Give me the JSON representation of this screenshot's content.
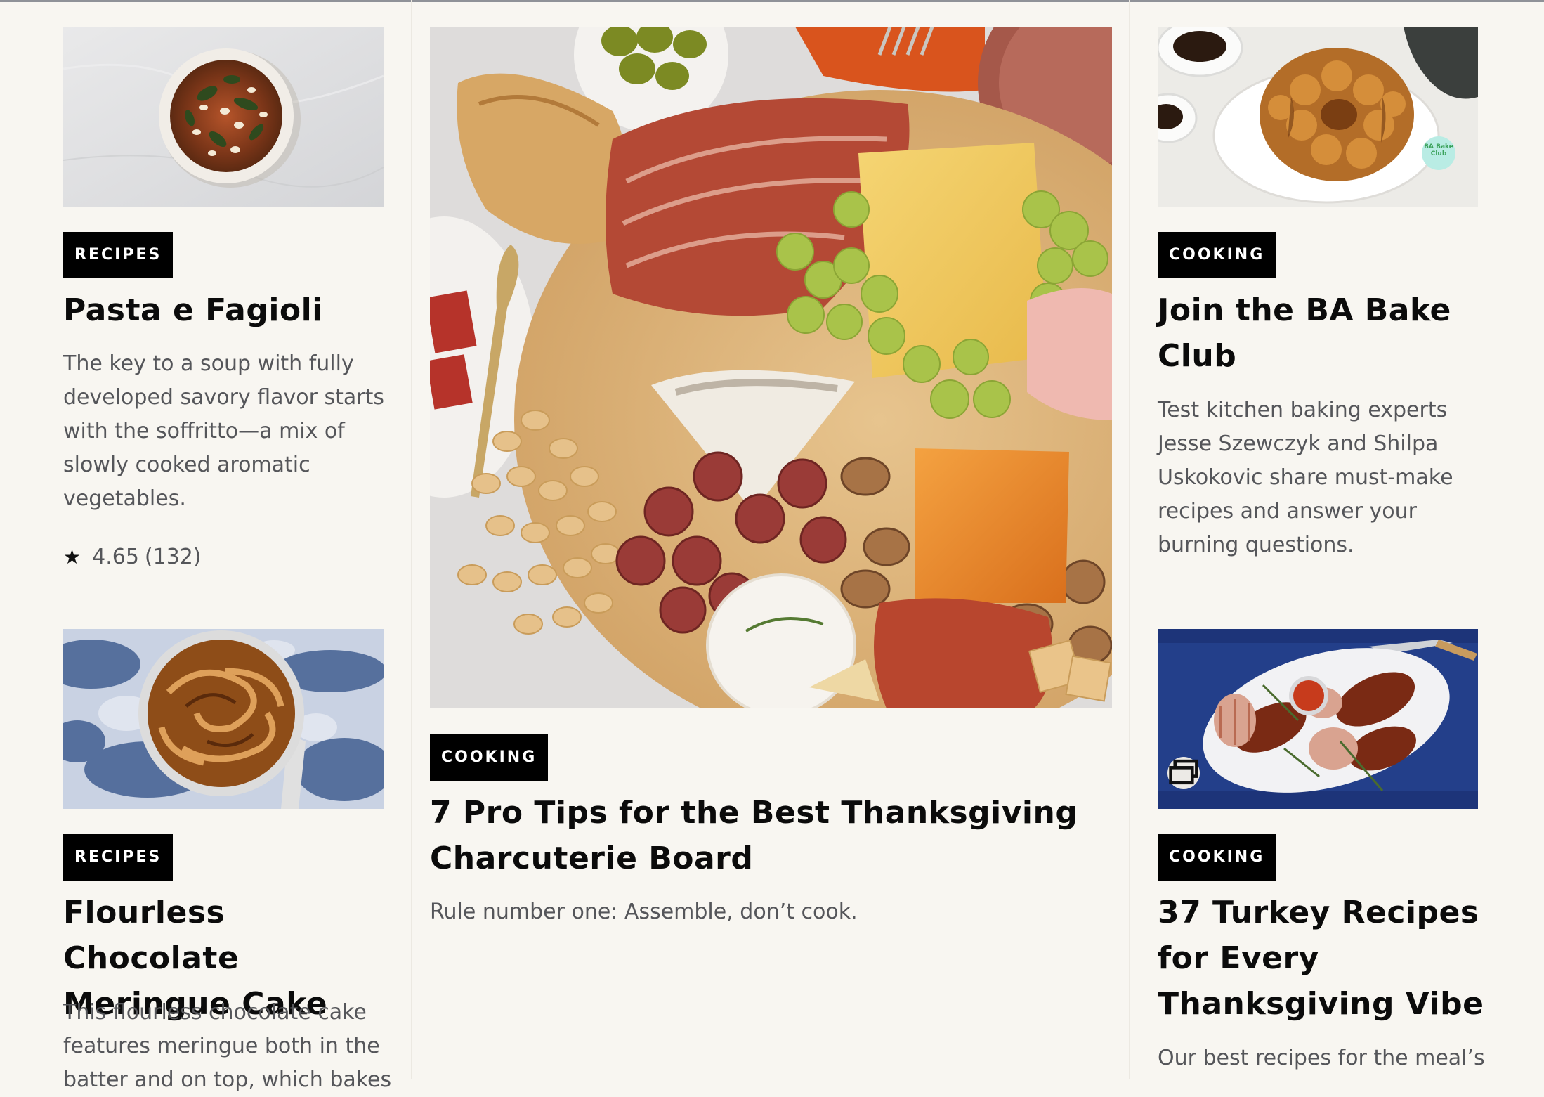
{
  "cards": {
    "pasta": {
      "category": "RECIPES",
      "title": "Pasta e Fagioli",
      "dek_lines": [
        "The key to a soup with fully",
        "developed savory flavor starts",
        "with the soffritto—a mix of",
        "slowly cooked aromatic",
        "vegetables."
      ],
      "rating_value": "4.65",
      "rating_count": "(132)"
    },
    "charcuterie": {
      "category": "COOKING",
      "title_lines": [
        "7 Pro Tips for the Best Thanksgiving",
        "Charcuterie Board"
      ],
      "dek": "Rule number one: Assemble, don’t cook."
    },
    "bakeclub": {
      "category": "COOKING",
      "title_lines": [
        "Join the BA Bake",
        "Club"
      ],
      "dek_lines": [
        "Test kitchen baking experts",
        "Jesse Szewczyk and Shilpa",
        "Uskokovic share must-make",
        "recipes and answer your",
        "burning questions."
      ],
      "image_badge_text": "BA Bake Club"
    },
    "chocolate": {
      "category": "RECIPES",
      "title_lines": [
        "Flourless Chocolate",
        "Meringue Cake"
      ],
      "dek_lines": [
        "This flourless chocolate cake",
        "features meringue both in the",
        "batter and on top, which bakes"
      ]
    },
    "turkey": {
      "category": "COOKING",
      "title_lines": [
        "37 Turkey Recipes",
        "for Every",
        "Thanksgiving Vibe"
      ],
      "dek_lines": [
        "Our best recipes for the meal’s"
      ]
    }
  },
  "icons": {
    "rating": "star-icon",
    "gallery": "gallery-icon"
  },
  "colors": {
    "page_background": "#f8f6f1",
    "badge_background": "#000000",
    "badge_text": "#ffffff",
    "title_text": "#0b0b0b",
    "dek_text": "#55565a"
  }
}
